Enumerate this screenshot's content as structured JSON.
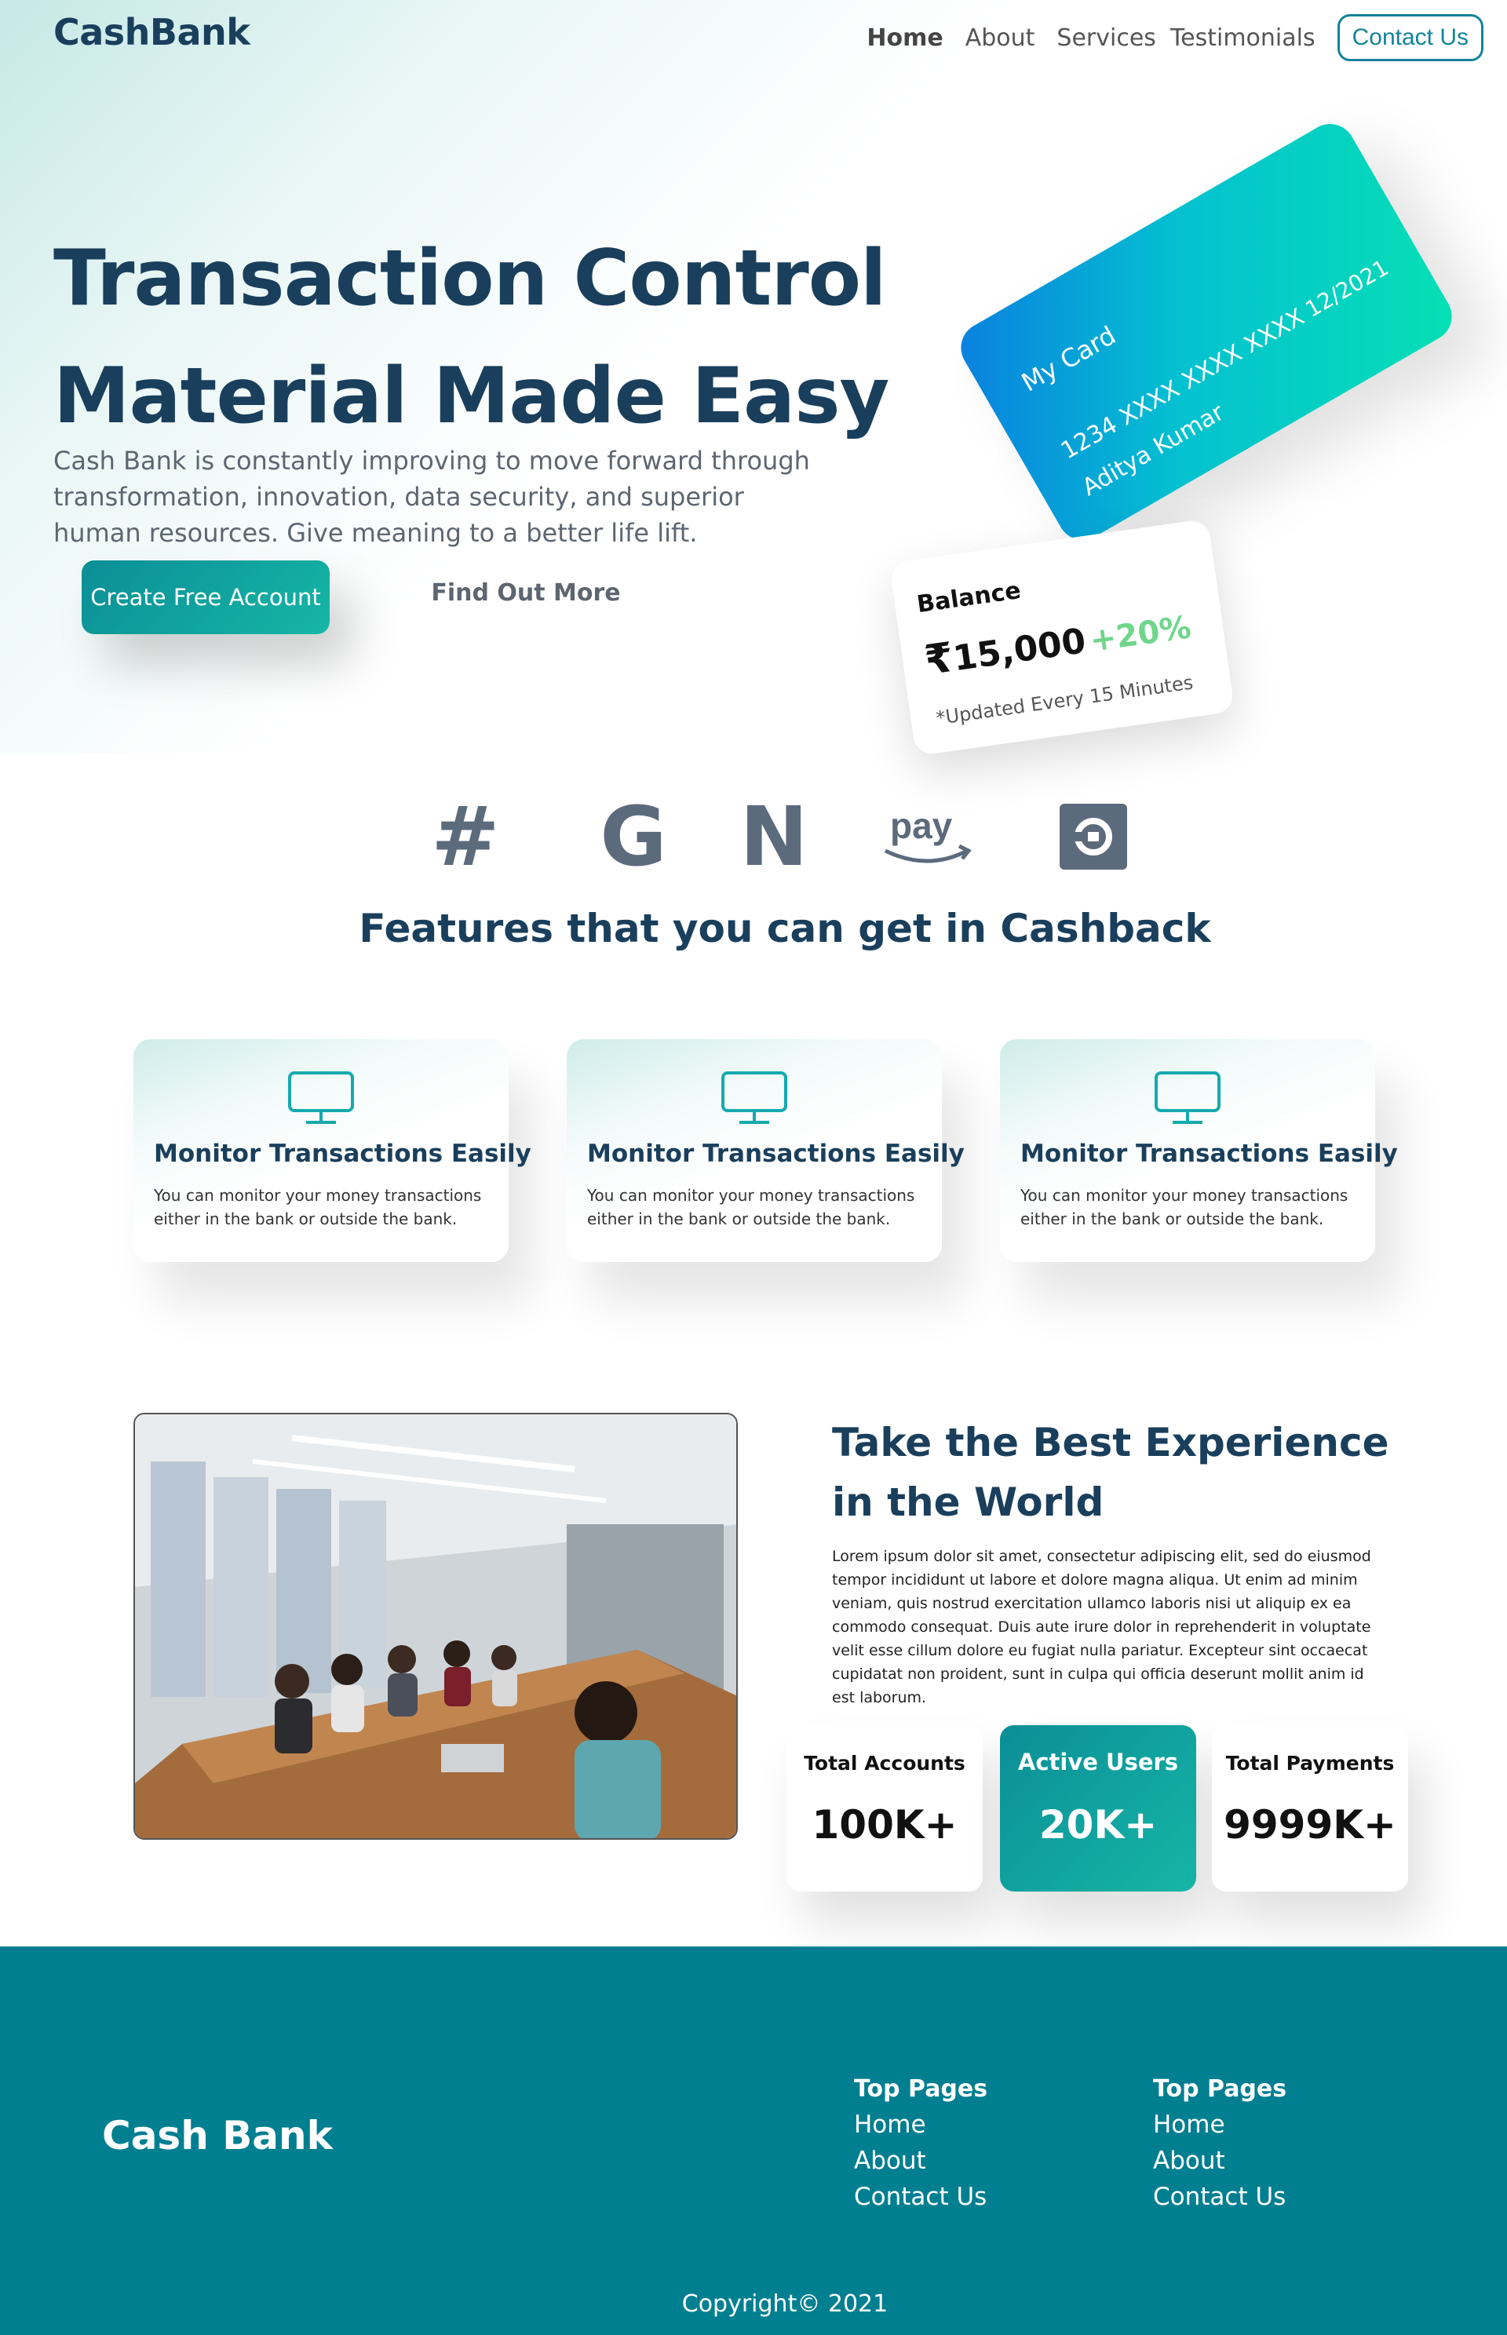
{
  "nav": {
    "logo": "CashBank",
    "links": [
      "Home",
      "About",
      "Services",
      "Testimonials"
    ],
    "contact": "Contact Us"
  },
  "hero": {
    "title": "Transaction Control Material Made Easy",
    "subtitle": "Cash Bank is constantly improving to move forward through transformation, innovation, data security, and superior human resources. Give meaning to a better life lift.",
    "primary_button": "Create Free Account",
    "secondary_button": "Find Out More"
  },
  "card": {
    "name": "My Card",
    "number": "1234 XXXX XXXX XXXX",
    "expiry": "12/2021",
    "holder": "Aditya Kumar"
  },
  "balance": {
    "title": "Balance",
    "currency": "₹",
    "amount": "15,000",
    "change": "+20%",
    "updated": "*Updated Every 15 Minutes"
  },
  "brands": {
    "pay_text": "pay"
  },
  "features": {
    "title": "Features that you can get in Cashback",
    "cards": [
      {
        "title": "Monitor Transactions Easily",
        "desc": "You can monitor your money transactions either in the bank or outside the bank."
      },
      {
        "title": "Monitor Transactions Easily",
        "desc": "You can monitor your money transactions either in the bank or outside the bank."
      },
      {
        "title": "Monitor Transactions Easily",
        "desc": "You can monitor your money transactions either in the bank or outside the bank."
      }
    ]
  },
  "experience": {
    "title": "Take the Best Experience in the World",
    "body": "Lorem ipsum dolor sit amet, consectetur adipiscing elit, sed do eiusmod tempor incididunt ut labore et dolore magna aliqua. Ut enim ad minim veniam, quis nostrud exercitation ullamco laboris nisi ut aliquip ex ea commodo consequat. Duis aute irure dolor in reprehenderit in voluptate velit esse cillum dolore eu fugiat nulla pariatur. Excepteur sint occaecat cupidatat non proident, sunt in culpa qui officia deserunt mollit anim id est laborum.",
    "stats": [
      {
        "label": "Total Accounts",
        "value": "100K+"
      },
      {
        "label": "Active Users",
        "value": "20K+"
      },
      {
        "label": "Total Payments",
        "value": "9999K+"
      }
    ]
  },
  "footer": {
    "brand": "Cash Bank",
    "columns": [
      {
        "title": "Top Pages",
        "links": [
          "Home",
          "About",
          "Contact Us"
        ]
      },
      {
        "title": "Top Pages",
        "links": [
          "Home",
          "About",
          "Contact Us"
        ]
      }
    ],
    "copyright": "Copyright© 2021"
  },
  "colors": {
    "primary": "#1a3f5c",
    "accent": "#13839a",
    "teal_gradient_start": "#0b8e96",
    "teal_gradient_end": "#16b6a6",
    "footer": "#007f91",
    "positive": "#6fd68c"
  },
  "icons": [
    "hashtag-logo-icon",
    "google-logo-icon",
    "netflix-logo-icon",
    "amazon-pay-logo-icon",
    "uber-logo-icon",
    "monitor-icon"
  ]
}
